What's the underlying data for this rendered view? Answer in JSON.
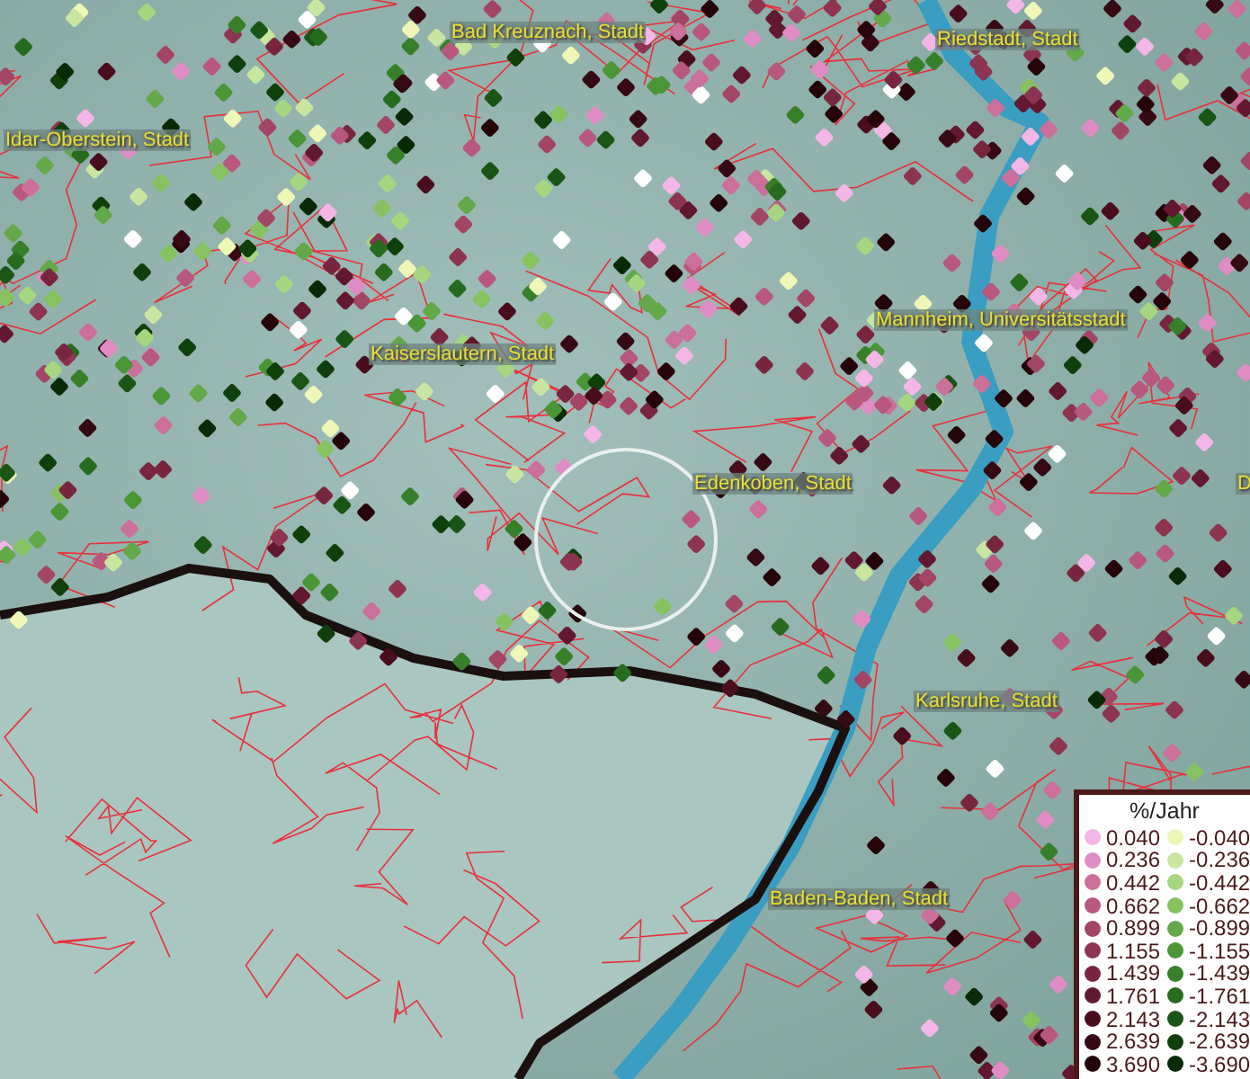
{
  "map": {
    "places": [
      {
        "name": "Bad Kreuznach, Stadt"
      },
      {
        "name": "Riedstadt, Stadt"
      },
      {
        "name": "Idar-Oberstein, Stadt"
      },
      {
        "name": "Mannheim, Universitätsstadt"
      },
      {
        "name": "Kaiserslautern, Stadt"
      },
      {
        "name": "Edenkoben, Stadt"
      },
      {
        "name": "D"
      },
      {
        "name": "Karlsruhe, Stadt"
      },
      {
        "name": "Baden-Baden, Stadt"
      }
    ]
  },
  "legend": {
    "title": "%/Jahr",
    "positive": [
      {
        "label": "0.040",
        "color": "#f4b6e6"
      },
      {
        "label": "0.236",
        "color": "#e08cc4"
      },
      {
        "label": "0.442",
        "color": "#cc6f9a"
      },
      {
        "label": "0.662",
        "color": "#b8587f"
      },
      {
        "label": "0.899",
        "color": "#a34565"
      },
      {
        "label": "1.155",
        "color": "#8c3450"
      },
      {
        "label": "1.439",
        "color": "#78263f"
      },
      {
        "label": "1.761",
        "color": "#621830"
      },
      {
        "label": "2.143",
        "color": "#4a0d1e"
      },
      {
        "label": "2.639",
        "color": "#360a14"
      },
      {
        "label": "3.690",
        "color": "#250509"
      }
    ],
    "negative": [
      {
        "label": "-0.040",
        "color": "#eef7b6"
      },
      {
        "label": "-0.236",
        "color": "#c9e6a0"
      },
      {
        "label": "-0.442",
        "color": "#a6d67f"
      },
      {
        "label": "-0.662",
        "color": "#86c260"
      },
      {
        "label": "-0.899",
        "color": "#63a849"
      },
      {
        "label": "-1.155",
        "color": "#4a9535"
      },
      {
        "label": "-1.439",
        "color": "#387f2a"
      },
      {
        "label": "-1.761",
        "color": "#276b1f"
      },
      {
        "label": "-2.143",
        "color": "#1a5515"
      },
      {
        "label": "-2.639",
        "color": "#0f400c"
      },
      {
        "label": "-3.690",
        "color": "#082a06"
      }
    ]
  }
}
